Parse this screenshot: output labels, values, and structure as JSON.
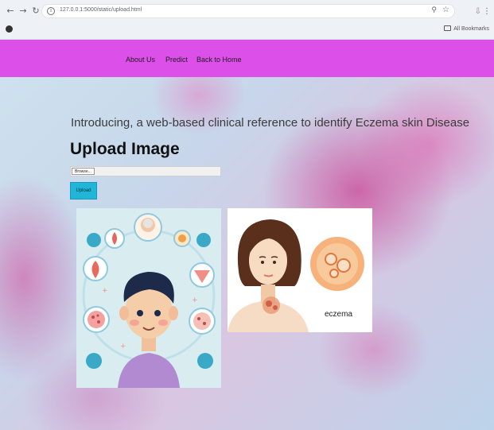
{
  "browser": {
    "url": "127.0.0.1:5000/static/upload.html",
    "bookmarks_label": "All Bookmarks"
  },
  "nav": {
    "items": [
      {
        "label": "About Us"
      },
      {
        "label": "Predict"
      },
      {
        "label": "Back to Home"
      }
    ],
    "color": "#dc4fe8"
  },
  "main": {
    "intro": "Introducing, a web-based clinical reference to identify Eczema skin Disease",
    "title": "Upload Image",
    "browse_label": "Browse...",
    "upload_label": "Upload"
  },
  "images": {
    "left_icon": "child-skin-conditions-illustration",
    "right_icon": "woman-eczema-illustration",
    "right_label": "eczema"
  },
  "colors": {
    "upload_button": "#1fb6d8"
  }
}
